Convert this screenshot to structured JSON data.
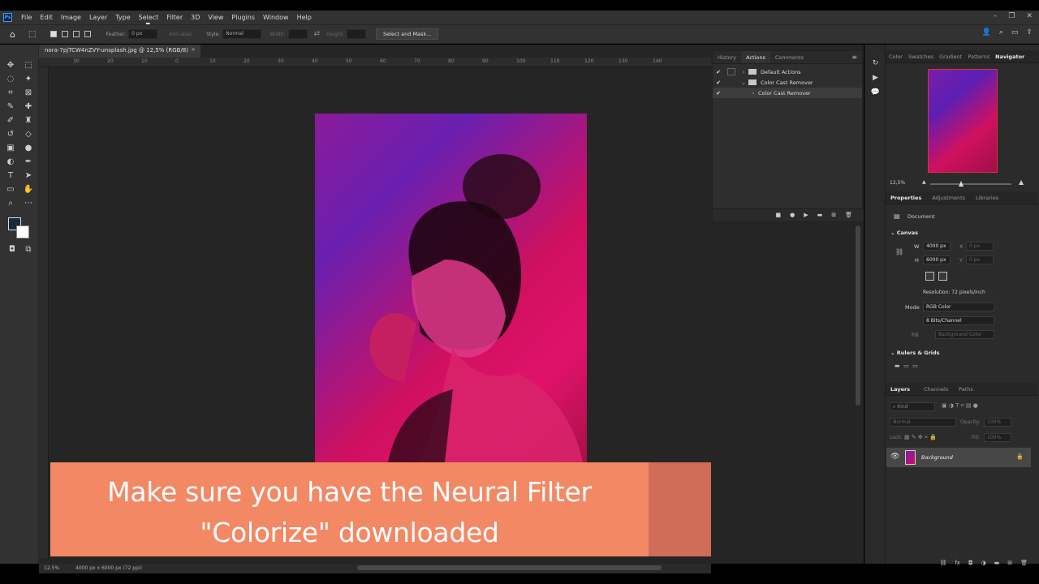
{
  "app": {
    "logo": "Ps",
    "menu": [
      "File",
      "Edit",
      "Image",
      "Layer",
      "Type",
      "Select",
      "Filter",
      "3D",
      "View",
      "Plugins",
      "Window",
      "Help"
    ],
    "window_controls": [
      "–",
      "❐",
      "✕"
    ]
  },
  "options_bar": {
    "feather_label": "Feather:",
    "feather_value": "0 px",
    "anti_alias_label": "Anti-alias",
    "style_label": "Style:",
    "style_value": "Normal",
    "width_label": "Width:",
    "height_label": "Height:",
    "select_mask_label": "Select and Mask..."
  },
  "document": {
    "tab_title": "nora-7pjTCW4nZVY-unsplash.jpg @ 12,5% (RGB/8)",
    "ruler_ticks": [
      "30",
      "20",
      "10",
      "0",
      "10",
      "20",
      "30",
      "40",
      "50",
      "60",
      "70",
      "80",
      "90",
      "100",
      "110",
      "120",
      "130",
      "140"
    ],
    "status_zoom": "12,5%",
    "status_info": "4000 px x 6000 px (72 ppi)"
  },
  "history_panel": {
    "tabs": [
      "History",
      "Actions",
      "Comments"
    ],
    "active_tab": "Actions",
    "rows": [
      {
        "label": "Default Actions",
        "checked": true
      },
      {
        "label": "Color Cast Remover",
        "checked": true
      },
      {
        "label": "Color Cast Remover",
        "checked": true
      }
    ]
  },
  "navigator_panel": {
    "tabs": [
      "Color",
      "Swatches",
      "Gradient",
      "Patterns",
      "Navigator"
    ],
    "active_tab": "Navigator",
    "zoom": "12,5%"
  },
  "properties_panel": {
    "tabs": [
      "Properties",
      "Adjustments",
      "Libraries"
    ],
    "document_label": "Document",
    "canvas_title": "Canvas",
    "w_label": "W",
    "w_value": "4000 px",
    "h_label": "H",
    "h_value": "6000 px",
    "x_label": "X",
    "x_value": "0 px",
    "y_label": "Y",
    "y_value": "0 px",
    "resolution": "Resolution: 72 pixels/inch",
    "mode_label": "Mode",
    "mode_value": "RGB Color",
    "bits_value": "8 Bits/Channel",
    "fill_label": "Fill",
    "fill_value": "Background Color",
    "rulers_title": "Rulers & Grids"
  },
  "layers_panel": {
    "tabs": [
      "Layers",
      "Channels",
      "Paths"
    ],
    "kind_placeholder": "Kind",
    "blend_mode": "Normal",
    "opacity_label": "Opacity:",
    "opacity_value": "100%",
    "lock_label": "Lock:",
    "fill_label": "Fill:",
    "fill_value": "100%",
    "layers": [
      {
        "name": "Background",
        "visible": true,
        "locked": true
      }
    ]
  },
  "caption": {
    "line1": "Make sure you have the Neural Filter",
    "line2": "\"Colorize\" downloaded"
  },
  "colors": {
    "caption_bg": "#f38865",
    "caption_tint": "#cf6d58",
    "ui_dark": "#323232"
  }
}
